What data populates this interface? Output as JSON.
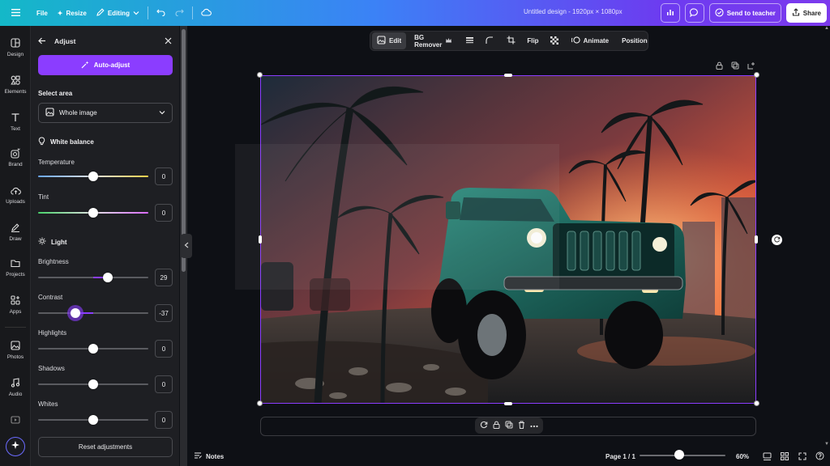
{
  "topbar": {
    "file_label": "File",
    "resize_label": "Resize",
    "editing_label": "Editing",
    "doc_title": "Untitled design - 1920px × 1080px",
    "send_label": "Send to teacher",
    "share_label": "Share"
  },
  "rail": {
    "items": [
      {
        "label": "Design",
        "icon": "design-icon"
      },
      {
        "label": "Elements",
        "icon": "elements-icon"
      },
      {
        "label": "Text",
        "icon": "text-icon"
      },
      {
        "label": "Brand",
        "icon": "brand-icon"
      },
      {
        "label": "Uploads",
        "icon": "uploads-icon"
      },
      {
        "label": "Draw",
        "icon": "draw-icon"
      },
      {
        "label": "Projects",
        "icon": "projects-icon"
      },
      {
        "label": "Apps",
        "icon": "apps-icon"
      },
      {
        "label": "Photos",
        "icon": "photos-icon"
      },
      {
        "label": "Audio",
        "icon": "audio-icon"
      }
    ]
  },
  "panel": {
    "title": "Adjust",
    "auto_adjust_label": "Auto-adjust",
    "select_area_label": "Select area",
    "select_value": "Whole image",
    "white_balance_label": "White balance",
    "light_label": "Light",
    "reset_label": "Reset adjustments",
    "sliders": {
      "temperature": {
        "label": "Temperature",
        "value": "0"
      },
      "tint": {
        "label": "Tint",
        "value": "0"
      },
      "brightness": {
        "label": "Brightness",
        "value": "29"
      },
      "contrast": {
        "label": "Contrast",
        "value": "-37"
      },
      "highlights": {
        "label": "Highlights",
        "value": "0"
      },
      "shadows": {
        "label": "Shadows",
        "value": "0"
      },
      "whites": {
        "label": "Whites",
        "value": "0"
      }
    }
  },
  "context_toolbar": {
    "edit_label": "Edit",
    "bg_remover_label": "BG Remover",
    "flip_label": "Flip",
    "animate_label": "Animate",
    "position_label": "Position"
  },
  "status": {
    "notes_label": "Notes",
    "page_label": "Page 1 / 1",
    "zoom_label": "60%",
    "zoom_level_percent": 60
  },
  "colors": {
    "accent": "#8b3dff",
    "topbar_start": "#14b8c8",
    "topbar_end": "#7c3aed"
  }
}
